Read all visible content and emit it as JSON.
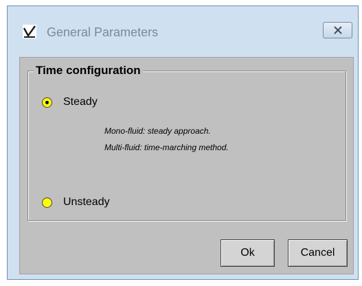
{
  "window": {
    "title": "General Parameters",
    "app_icon": "check-mark-app-icon",
    "close_icon": "close-icon"
  },
  "group": {
    "legend": "Time configuration"
  },
  "options": [
    {
      "label": "Steady",
      "selected": true
    },
    {
      "label": "Unsteady",
      "selected": false
    }
  ],
  "description": {
    "line1": "Mono-fluid: steady approach.",
    "line2": "Multi-fluid: time-marching method."
  },
  "buttons": {
    "ok_label": "Ok",
    "cancel_label": "Cancel"
  },
  "colors": {
    "title_bar": "#cfe0f1",
    "client_bg": "#c0c0c0",
    "radio_fill": "#ffff00"
  }
}
